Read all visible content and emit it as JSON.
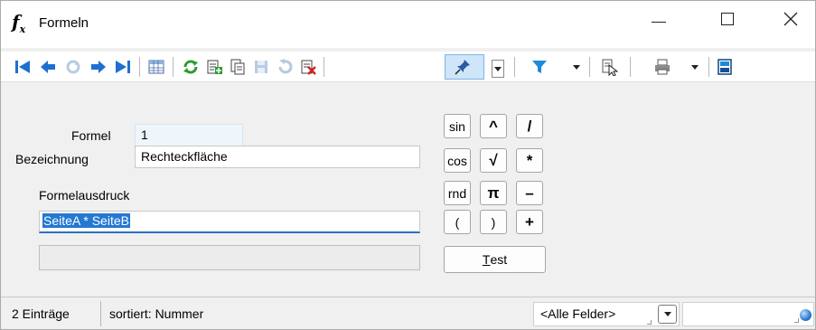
{
  "window": {
    "title": "Formeln",
    "icon": "function-fx-icon",
    "icon_text": "f",
    "icon_sub": "x"
  },
  "toolbar": {
    "buttons": [
      "first-record-icon",
      "previous-record-icon",
      "refresh-disabled-icon",
      "next-record-icon",
      "last-record-icon",
      "grid-view-icon",
      "reload-icon",
      "new-record-icon",
      "copy-record-icon",
      "save-icon",
      "undo-icon",
      "delete-icon",
      "pin-icon",
      "filter-icon",
      "field-select-icon",
      "print-icon",
      "layout-icon"
    ]
  },
  "form": {
    "formel_label": "Formel",
    "formel_value": "1",
    "bezeichnung_label": "Bezeichnung",
    "bezeichnung_value": "Rechteckfläche",
    "ausdruck_label": "Formelausdruck",
    "ausdruck_value": "SeiteA * SeiteB",
    "result_value": ""
  },
  "keypad": {
    "sin": "sin",
    "caret": "^",
    "slash": "/",
    "cos": "cos",
    "sqrt": "√",
    "times": "*",
    "rnd": "rnd",
    "pi": "π",
    "minus": "–",
    "lparen": "(",
    "rparen": ")",
    "plus": "+",
    "test_prefix": "",
    "test_accel": "T",
    "test_rest": "est"
  },
  "status": {
    "count": "2 Einträge",
    "sort": "sortiert: Nummer",
    "field_combo": "<Alle Felder>",
    "search_value": ""
  },
  "colors": {
    "accent": "#2478d2",
    "toolbar_blue": "#1e6fd0",
    "refresh_green": "#2f9a2f",
    "delete_red": "#d32020"
  }
}
